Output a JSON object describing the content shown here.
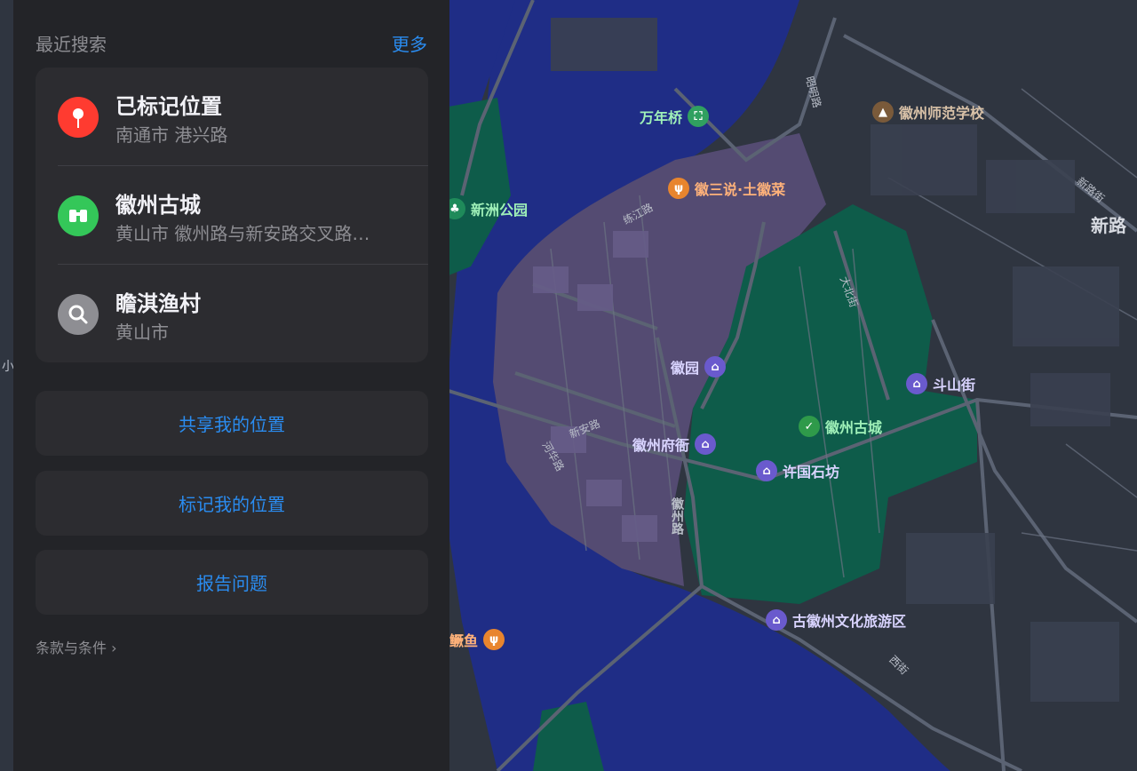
{
  "sidebar": {
    "header_title": "最近搜索",
    "header_more": "更多",
    "recent": [
      {
        "title": "已标记位置",
        "subtitle": "南通市 港兴路",
        "icon": "map-pin-icon",
        "color": "#ff3b30"
      },
      {
        "title": "徽州古城",
        "subtitle": "黄山市 徽州路与新安路交叉路…",
        "icon": "binoculars-icon",
        "color": "#34c759"
      },
      {
        "title": "瞻淇渔村",
        "subtitle": "黄山市",
        "icon": "search-icon",
        "color": "#8e8e93"
      }
    ],
    "buttons": {
      "share": "共享我的位置",
      "mark": "标记我的位置",
      "report": "报告问题"
    },
    "terms": "条款与条件 ›"
  },
  "map": {
    "pois": {
      "wannianqiao": "万年桥",
      "huishan_cai": "徽三说·土徽菜",
      "xinzhou_park": "新洲公园",
      "normal_school": "徽州师范学校",
      "huiyuan": "徽园",
      "doushan": "斗山街",
      "gucheng": "徽州古城",
      "fuya": "徽州府衙",
      "xuguo": "许国石坊",
      "tourism": "古徽州文化旅游区",
      "guiyu": "鳜鱼"
    },
    "roads": {
      "xinan": "新安路",
      "huizhou": "徽州路",
      "lianjiang": "练江路",
      "hehua": "河华路",
      "dabei": "大北街",
      "zhaomin": "昭明路",
      "xinlu": "新路街",
      "xinlu_big": "新路",
      "xijie": "西街",
      "xiao": "小"
    }
  },
  "colors": {
    "accent": "#2a8cf0",
    "panel": "#232428",
    "card": "#2c2c30",
    "water": "#1f2d86",
    "park": "#0e5c4a",
    "old_town": "#5a4f7a"
  }
}
